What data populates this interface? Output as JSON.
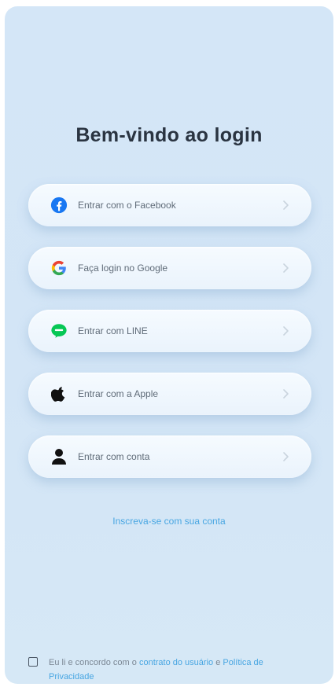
{
  "page": {
    "title": "Bem-vindo ao login"
  },
  "login_options": [
    {
      "label": "Entrar com o Facebook",
      "icon": "facebook-icon"
    },
    {
      "label": "Faça login no Google",
      "icon": "google-icon"
    },
    {
      "label": "Entrar com LINE",
      "icon": "line-icon"
    },
    {
      "label": "Entrar com a Apple",
      "icon": "apple-icon"
    },
    {
      "label": "Entrar com conta",
      "icon": "user-icon"
    }
  ],
  "register_link": "Inscreva-se com sua conta",
  "consent": {
    "prefix": "Eu li e concordo com o",
    "terms_link": "contrato do usuário",
    "connector": "e",
    "privacy_link": "Política de Privacidade"
  },
  "colors": {
    "accent": "#48a6e2",
    "background": "#d4e6f7",
    "facebook": "#1877f2",
    "line": "#06c755"
  }
}
